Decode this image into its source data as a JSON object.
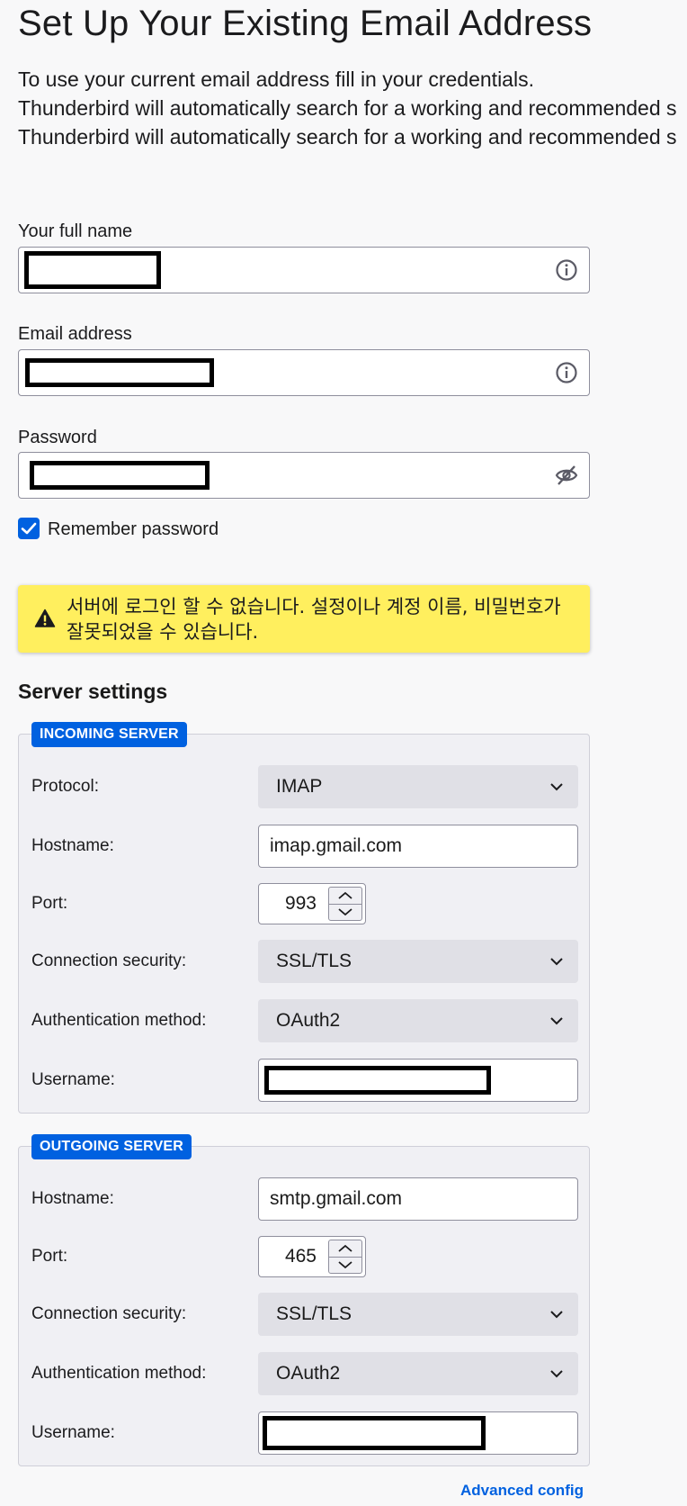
{
  "page": {
    "title": "Set Up Your Existing Email Address",
    "intro": [
      "To use your current email address fill in your credentials.",
      "Thunderbird will automatically search for a working and recommended s",
      "Thunderbird will automatically search for a working and recommended s"
    ]
  },
  "form": {
    "full_name": {
      "label": "Your full name",
      "icon": "info-icon"
    },
    "email": {
      "label": "Email address",
      "icon": "info-icon"
    },
    "password": {
      "label": "Password",
      "icon": "eye-slash-icon"
    },
    "remember_password": {
      "label": "Remember password",
      "checked": true
    }
  },
  "warning": {
    "icon": "warning-triangle-icon",
    "text": "서버에 로그인 할 수 없습니다. 설정이나 계정 이름, 비밀번호가 잘못되었을 수 있습니다."
  },
  "server_settings": {
    "title": "Server settings",
    "incoming": {
      "legend": "INCOMING SERVER",
      "protocol": {
        "label": "Protocol:",
        "value": "IMAP"
      },
      "hostname": {
        "label": "Hostname:",
        "value": "imap.gmail.com"
      },
      "port": {
        "label": "Port:",
        "value": "993"
      },
      "security": {
        "label": "Connection security:",
        "value": "SSL/TLS"
      },
      "auth": {
        "label": "Authentication method:",
        "value": "OAuth2"
      },
      "username": {
        "label": "Username:"
      }
    },
    "outgoing": {
      "legend": "OUTGOING SERVER",
      "hostname": {
        "label": "Hostname:",
        "value": "smtp.gmail.com"
      },
      "port": {
        "label": "Port:",
        "value": "465"
      },
      "security": {
        "label": "Connection security:",
        "value": "SSL/TLS"
      },
      "auth": {
        "label": "Authentication method:",
        "value": "OAuth2"
      },
      "username": {
        "label": "Username:"
      }
    }
  },
  "footer": {
    "advanced_config": "Advanced config"
  },
  "colors": {
    "accent": "#0061e0",
    "warning_bg": "#ffef5e",
    "select_bg": "#e0e0e6",
    "fieldset_bg": "#f0f0f4"
  }
}
